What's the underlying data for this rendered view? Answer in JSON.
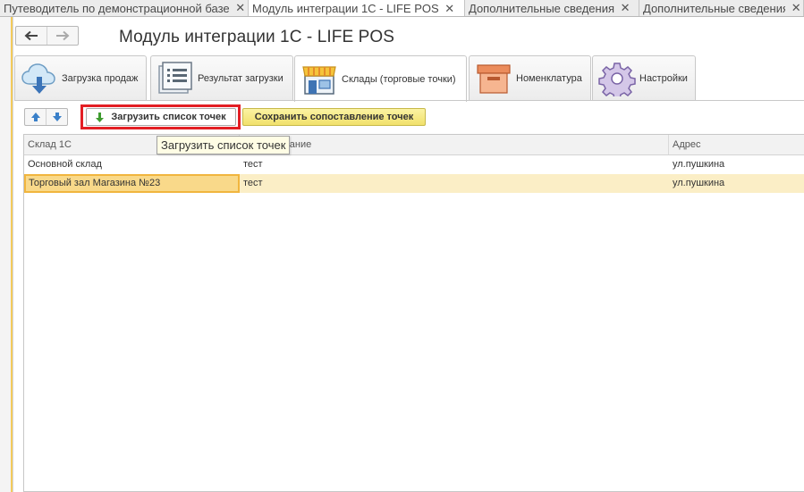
{
  "window_tabs": [
    {
      "label": "Путеводитель по демонстрационной базе",
      "close": "✕"
    },
    {
      "label": "Модуль интеграции 1С - LIFE POS",
      "close": "✕"
    },
    {
      "label": "Дополнительные сведения",
      "close": "✕"
    },
    {
      "label": "Дополнительные сведения",
      "close": "✕"
    }
  ],
  "page": {
    "title": "Модуль интеграции 1С - LIFE POS"
  },
  "form_tabs": [
    {
      "label": "Загрузка продаж",
      "icon": "cloud-download-icon"
    },
    {
      "label": "Результат загрузки",
      "icon": "list-icon"
    },
    {
      "label": "Склады (торговые точки)",
      "icon": "store-icon"
    },
    {
      "label": "Номенклатура",
      "icon": "box-icon"
    },
    {
      "label": "Настройки",
      "icon": "gear-icon"
    }
  ],
  "toolbar": {
    "load_points_label": "Загрузить список точек",
    "save_mapping_label": "Сохранить сопоставление точек"
  },
  "tooltip": {
    "text": "Загрузить список точек"
  },
  "table": {
    "columns": [
      "Склад 1С",
      "Наименование",
      "Адрес"
    ],
    "rows": [
      {
        "warehouse": "Основной склад",
        "name": "тест",
        "address": "ул.пушкина"
      },
      {
        "warehouse": "Торговый зал Магазина №23",
        "name": "тест",
        "address": "ул.пушкина"
      }
    ]
  },
  "colors": {
    "accent_yellow": "#f3cb5b",
    "highlight_red": "#e31e24",
    "selected_row": "#fbeec6",
    "save_button": "#f1e16b"
  }
}
